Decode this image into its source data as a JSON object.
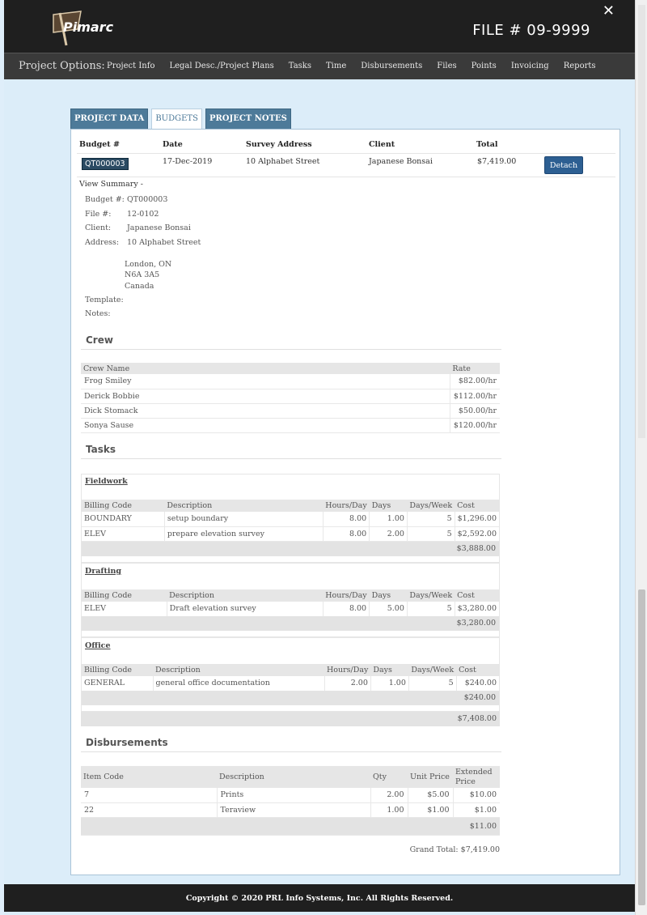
{
  "header": {
    "logo_text": "Pimarc",
    "file_title": "FILE # 09-9999",
    "close_symbol": "✕"
  },
  "nav": {
    "label": "Project Options:",
    "items": [
      "Project Info",
      "Legal Desc./Project Plans",
      "Tasks",
      "Time",
      "Disbursements",
      "Files",
      "Points",
      "Invoicing",
      "Reports"
    ]
  },
  "tabs": {
    "project_data": "PROJECT DATA",
    "budgets": "BUDGETS",
    "project_notes": "PROJECT NOTES"
  },
  "budget_table": {
    "headers": [
      "Budget #",
      "Date",
      "Survey Address",
      "Client",
      "Total"
    ],
    "row": {
      "budget_no": "QT000003",
      "date": "17-Dec-2019",
      "address": "10 Alphabet Street",
      "client": "Japanese Bonsai",
      "total": "$7,419.00",
      "action": "Detach"
    }
  },
  "summary": {
    "link": "View Summary -",
    "budget_label": "Budget #:",
    "budget_value": "QT000003",
    "file_label": "File #:",
    "file_value": "12-0102",
    "client_label": "Client:",
    "client_value": "Japanese Bonsai",
    "address_label": "Address:",
    "address_line1": "10 Alphabet Street",
    "address_line2": "London, ON",
    "address_line3": "N6A 3A5",
    "address_line4": "Canada",
    "template_label": "Template:",
    "notes_label": "Notes:"
  },
  "crew": {
    "title": "Crew",
    "headers": [
      "Crew Name",
      "Rate"
    ],
    "rows": [
      [
        "Frog Smiley",
        "$82.00/hr"
      ],
      [
        "Derick Bobbie",
        "$112.00/hr"
      ],
      [
        "Dick Stomack",
        "$50.00/hr"
      ],
      [
        "Sonya Sause",
        "$120.00/hr"
      ]
    ]
  },
  "tasks": {
    "title": "Tasks",
    "headers": [
      "Billing Code",
      "Description",
      "Hours/Day",
      "Days",
      "Days/Week",
      "Cost"
    ],
    "fieldwork": {
      "title": "Fieldwork",
      "rows": [
        [
          "BOUNDARY",
          "setup boundary",
          "8.00",
          "1.00",
          "5",
          "$1,296.00"
        ],
        [
          "ELEV",
          "prepare elevation survey",
          "8.00",
          "2.00",
          "5",
          "$2,592.00"
        ]
      ],
      "subtotal": "$3,888.00"
    },
    "drafting": {
      "title": "Drafting",
      "rows": [
        [
          "ELEV",
          "Draft elevation survey",
          "8.00",
          "5.00",
          "5",
          "$3,280.00"
        ]
      ],
      "subtotal": "$3,280.00"
    },
    "office": {
      "title": "Office",
      "rows": [
        [
          "GENERAL",
          "general office documentation",
          "2.00",
          "1.00",
          "5",
          "$240.00"
        ]
      ],
      "subtotal": "$240.00"
    },
    "total": "$7,408.00"
  },
  "disbursements": {
    "title": "Disbursements",
    "headers": [
      "Item Code",
      "Description",
      "Qty",
      "Unit Price",
      "Extended",
      "Price"
    ],
    "rows": [
      [
        "7",
        "Prints",
        "2.00",
        "$5.00",
        "$10.00"
      ],
      [
        "22",
        "Teraview",
        "1.00",
        "$1.00",
        "$1.00"
      ]
    ],
    "total": "$11.00"
  },
  "grand_total": "Grand Total: $7,419.00",
  "footer": "Copyright © 2020 PRL Info Systems, Inc. All Rights Reserved."
}
